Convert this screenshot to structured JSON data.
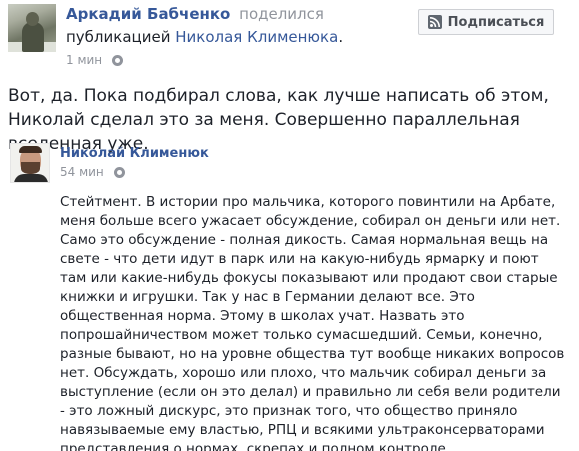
{
  "post": {
    "author": "Аркадий Бабченко",
    "action": "поделился",
    "shared_prefix": "публикацией",
    "shared_author": "Николая Клименюка",
    "shared_suffix": ".",
    "time": "1 мин",
    "text": "Вот, да. Пока подбирал слова, как лучше написать об этом, Николай сделал это за меня. Совершенно параллельная вселенная уже."
  },
  "subscribe": {
    "label": "Подписаться",
    "icon": "rss-icon"
  },
  "shared_post": {
    "author": "Николай Клименюк",
    "time": "54 мин",
    "text": "Стейтмент. В истории про мальчика, которого повинтили на Арбате, меня больше всего ужасает обсуждение, собирал он деньги или нет. Само это обсуждение - полная дикость. Самая нормальная вещь на свете - что дети идут в парк или на какую-нибудь ярмарку и поют там или какие-нибудь фокусы показывают или продают свои старые книжки и игрушки. Так у нас в Германии делают все. Это общественная норма. Этому в школах учат. Назвать это попрошайничеством может только сумасшедший. Семьи, конечно, разные бывают, но на уровне общества тут вообще никаких вопросов нет. Обсуждать, хорошо или плохо, что мальчик собирал деньги за выступление (если он это делал) и правильно ли себя вели родители - это ложный дискурс, это признак того, что общество приняло навязываемые ему властью, РПЦ и всякими ультраконсерваторами представления о нормах, скрепах и полном контроле."
  },
  "icons": {
    "privacy": "globe-icon"
  }
}
